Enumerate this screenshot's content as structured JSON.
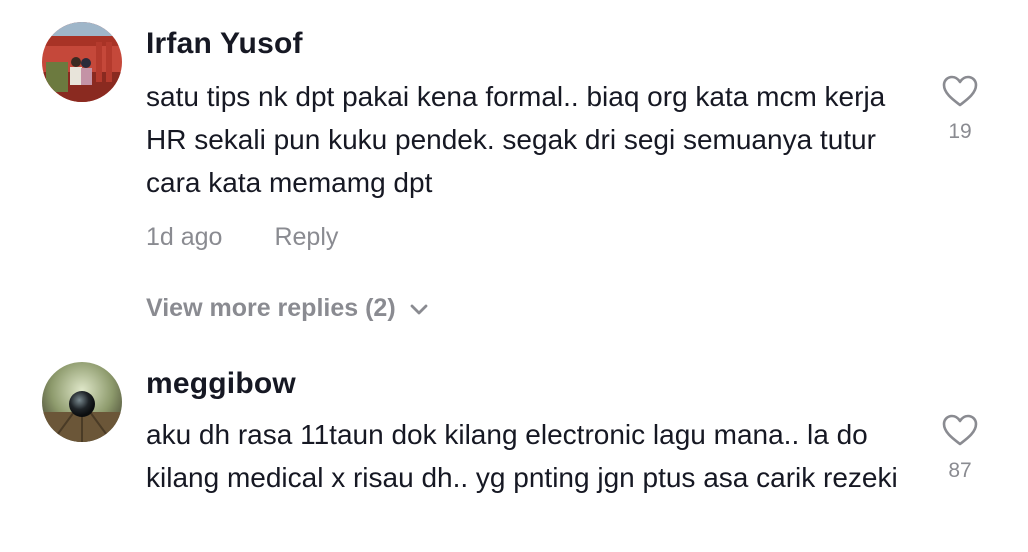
{
  "comments": [
    {
      "username": "Irfan Yusof",
      "text": "satu tips nk dpt pakai kena formal.. biaq org kata mcm kerja HR sekali pun kuku pendek. segak dri segi semuanya tutur cara kata memamg dpt",
      "time": "1d ago",
      "reply_label": "Reply",
      "likes": "19",
      "view_more_label": "View more replies (2)",
      "avatar_icon": "profile-photo"
    },
    {
      "username": "meggibow",
      "text": "aku dh rasa 11taun dok kilang electronic lagu mana.. la do kilang medical x risau dh.. yg pnting jgn ptus asa carik rezeki",
      "likes": "87",
      "avatar_icon": "profile-photo"
    }
  ],
  "icons": {
    "like": "heart-outline-icon",
    "expand": "chevron-down-icon"
  },
  "colors": {
    "text_primary": "#161823",
    "text_secondary": "#8a8b91",
    "background": "#ffffff"
  }
}
